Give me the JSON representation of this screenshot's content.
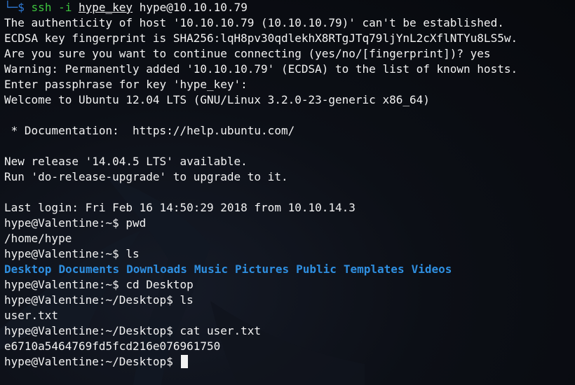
{
  "terminal": {
    "background": "#0b0d12",
    "foreground": "#f2f2f2",
    "directory_color": "#2f8fe0",
    "command_color": "#3ec43e",
    "first_line": {
      "corner_glyph": "└─$",
      "cmd": "ssh",
      "flag": "-i",
      "key": "hype_key",
      "target": "hype@10.10.10.79"
    },
    "output": {
      "auth_warning": "The authenticity of host '10.10.10.79 (10.10.10.79)' can't be established.",
      "fingerprint": "ECDSA key fingerprint is SHA256:lqH8pv30qdlekhX8RTgJTq79ljYnL2cXflNTYu8LS5w.",
      "continue_prompt": "Are you sure you want to continue connecting (yes/no/[fingerprint])? yes",
      "known_hosts": "Warning: Permanently added '10.10.10.79' (ECDSA) to the list of known hosts.",
      "passphrase": "Enter passphrase for key 'hype_key':",
      "welcome": "Welcome to Ubuntu 12.04 LTS (GNU/Linux 3.2.0-23-generic x86_64)",
      "documentation": " * Documentation:  https://help.ubuntu.com/",
      "new_release": "New release '14.04.5 LTS' available.",
      "upgrade_hint": "Run 'do-release-upgrade' to upgrade to it.",
      "last_login": "Last login: Fri Feb 16 14:50:29 2018 from 10.10.14.3"
    },
    "session": {
      "cmd_pwd": "hype@Valentine:~$ pwd",
      "pwd_result": "/home/hype",
      "cmd_ls": "hype@Valentine:~$ ls",
      "directories": [
        "Desktop",
        "Documents",
        "Downloads",
        "Music",
        "Pictures",
        "Public",
        "Templates",
        "Videos"
      ],
      "cmd_cd": "hype@Valentine:~$ cd Desktop",
      "cmd_ls_desktop": "hype@Valentine:~/Desktop$ ls",
      "ls_desktop_result": "user.txt",
      "cmd_cat": "hype@Valentine:~/Desktop$ cat user.txt",
      "user_flag": "e6710a5464769fd5fcd216e076961750",
      "final_prompt": "hype@Valentine:~/Desktop$ "
    }
  }
}
